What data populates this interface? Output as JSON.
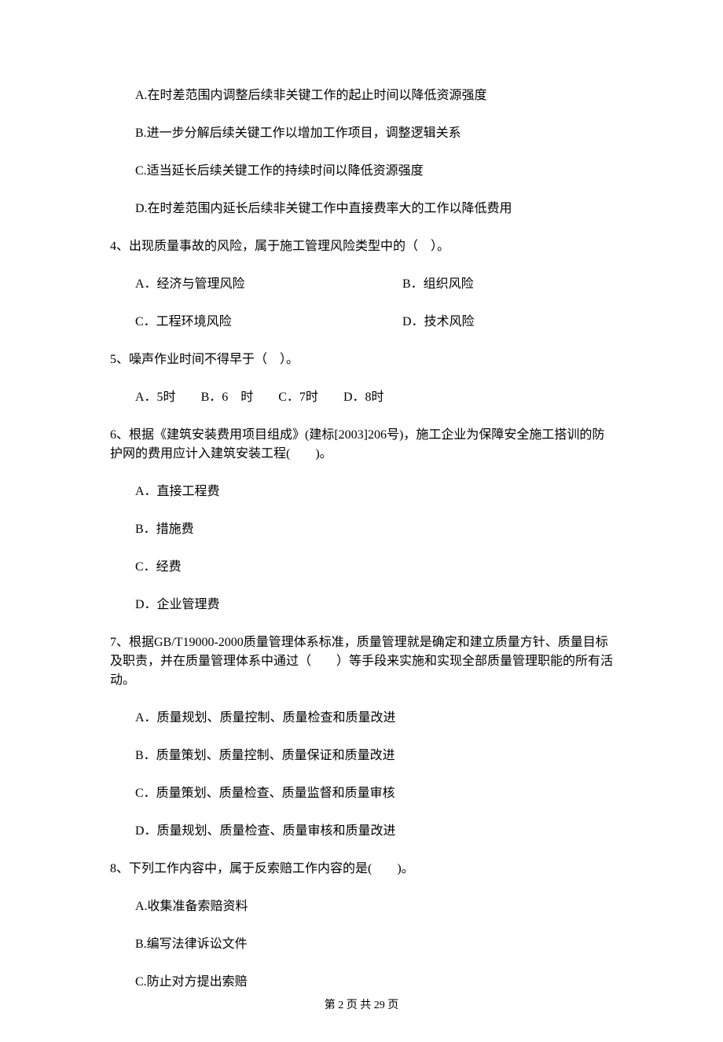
{
  "q3_options": {
    "A": "A.在时差范围内调整后续非关键工作的起止时间以降低资源强度",
    "B": "B.进一步分解后续关键工作以增加工作项目，调整逻辑关系",
    "C": "C.适当延长后续关键工作的持续时间以降低资源强度",
    "D": "D.在时差范围内延长后续非关键工作中直接费率大的工作以降低费用"
  },
  "q4": {
    "stem": "4、出现质量事故的风险，属于施工管理风险类型中的（　）。",
    "A": "A．经济与管理风险",
    "B": "B．组织风险",
    "C": "C．工程环境风险",
    "D": "D．技术风险"
  },
  "q5": {
    "stem": "5、噪声作业时间不得早于（　）。",
    "A": "A．5时",
    "B": "B．6　时",
    "C": "C．7时",
    "D": "D．8时"
  },
  "q6": {
    "stem": "6、根据《建筑安装费用项目组成》(建标[2003]206号)，施工企业为保障安全施工搭训的防护网的费用应计入建筑安装工程(　　)。",
    "A": "A．直接工程费",
    "B": "B．措施费",
    "C": "C．经费",
    "D": "D．企业管理费"
  },
  "q7": {
    "stem": "7、根据GB/T19000-2000质量管理体系标准，质量管理就是确定和建立质量方针、质量目标及职责，并在质量管理体系中通过（　　）等手段来实施和实现全部质量管理职能的所有活动。",
    "A": "A．质量规划、质量控制、质量检查和质量改进",
    "B": "B．质量策划、质量控制、质量保证和质量改进",
    "C": "C．质量策划、质量检查、质量监督和质量审核",
    "D": "D．质量规划、质量检查、质量审核和质量改进"
  },
  "q8": {
    "stem": "8、下列工作内容中，属于反索赔工作内容的是(　　)。",
    "A": "A.收集准备索赔资料",
    "B": "B.编写法律诉讼文件",
    "C": "C.防止对方提出索赔"
  },
  "footer": "第 2 页 共 29 页"
}
